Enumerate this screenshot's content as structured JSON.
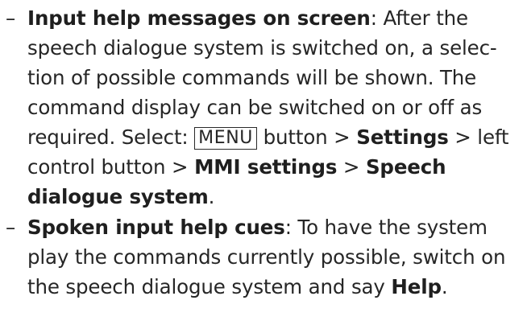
{
  "items": [
    {
      "dash": "–",
      "title": "Input help messages on screen",
      "body_1": ": After the speech dialogue system is switched on, a selec-tion of possible commands will be shown. The command display can be switched on or off as required. Select: ",
      "key_label": "MENU",
      "body_2": " button > ",
      "settings_label": "Settings",
      "body_3": " > left control button > ",
      "mmi_settings_label": "MMI settings",
      "separator": " > ",
      "speech_system_label": "Speech dialogue system",
      "end": "."
    },
    {
      "dash": "–",
      "title": "Spoken input help cues",
      "body_1": ": To have the system play the commands currently possible, switch on the speech dialogue system and say ",
      "help_label": "Help",
      "end": "."
    }
  ]
}
